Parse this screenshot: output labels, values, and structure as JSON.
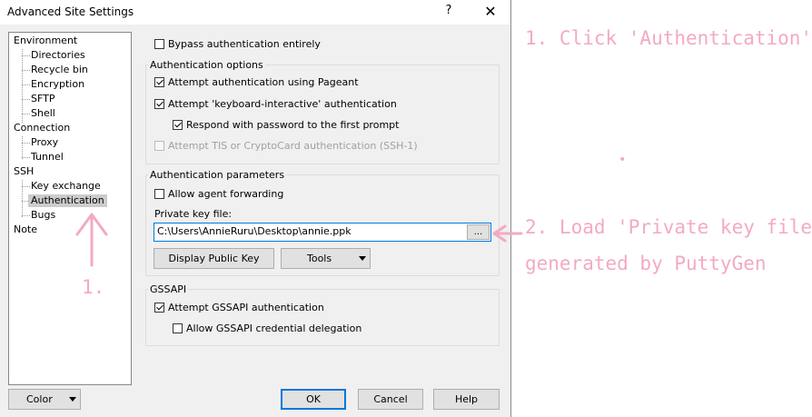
{
  "window": {
    "title": "Advanced Site Settings",
    "help_glyph": "?",
    "close_glyph": "✕"
  },
  "tree": {
    "environment": "Environment",
    "directories": "Directories",
    "recycle_bin": "Recycle bin",
    "encryption": "Encryption",
    "sftp": "SFTP",
    "shell": "Shell",
    "connection": "Connection",
    "proxy": "Proxy",
    "tunnel": "Tunnel",
    "ssh": "SSH",
    "key_exchange": "Key exchange",
    "authentication": "Authentication",
    "bugs": "Bugs",
    "note": "Note"
  },
  "bypass": {
    "label": "Bypass authentication entirely",
    "checked": false
  },
  "auth_options": {
    "title": "Authentication options",
    "pageant": {
      "label": "Attempt authentication using Pageant",
      "checked": true
    },
    "keyboard_interactive": {
      "label": "Attempt 'keyboard-interactive' authentication",
      "checked": true
    },
    "respond_password": {
      "label": "Respond with password to the first prompt",
      "checked": true
    },
    "tis": {
      "label": "Attempt TIS or CryptoCard authentication (SSH-1)",
      "checked": false,
      "disabled": true
    }
  },
  "auth_params": {
    "title": "Authentication parameters",
    "agent_forwarding": {
      "label": "Allow agent forwarding",
      "checked": false
    },
    "private_key_label": "Private key file:",
    "private_key_value": "C:\\Users\\AnnieRuru\\Desktop\\annie.ppk",
    "browse_label": "...",
    "display_public_key": "Display Public Key",
    "tools": "Tools"
  },
  "gssapi": {
    "title": "GSSAPI",
    "attempt": {
      "label": "Attempt GSSAPI authentication",
      "checked": true
    },
    "delegation": {
      "label": "Allow GSSAPI credential delegation",
      "checked": false
    }
  },
  "footer": {
    "color": "Color",
    "ok": "OK",
    "cancel": "Cancel",
    "help": "Help"
  },
  "annotations": {
    "step1_title": "1. Click 'Authentication'",
    "step1_short": "1.",
    "step2_line1": "2. Load 'Private key file'",
    "step2_line2": "generated by PuttyGen",
    "annotation_color": "#f4a9c5"
  }
}
